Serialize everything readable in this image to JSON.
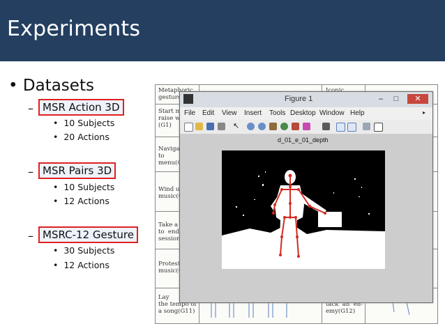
{
  "slide": {
    "title": "Experiments",
    "bullet": "Datasets",
    "datasets": [
      {
        "name": "MSR Action 3D",
        "details": [
          "10 Subjects",
          "20 Actions"
        ]
      },
      {
        "name": "MSR Pairs 3D",
        "details": [
          "10 Subjects",
          "12 Actions"
        ]
      },
      {
        "name": "MSRC-12 Gesture",
        "details": [
          "30 Subjects",
          "12 Actions"
        ]
      }
    ]
  },
  "paper_table": {
    "header_left": "Metaphoric\ngestures",
    "header_right": "Iconic",
    "rows": [
      "Start m\nraise w\n(G1)",
      "Naviga\nto\nmenu(G",
      "Wind u\nmusic(G",
      "Take a\nto  end\nsession(",
      "Protest\nmusic(G",
      "Lay\nthe tempo of\na song(G11)"
    ],
    "right_bottom": "tack  an  en-\nemy(G12)"
  },
  "figure_window": {
    "title": "Figure 1",
    "menu": [
      "File",
      "Edit",
      "View",
      "Insert",
      "Tools",
      "Desktop",
      "Window",
      "Help"
    ],
    "plot_title": "d_01_e_01_depth"
  },
  "colors": {
    "title_bar": "#243f60",
    "highlight_border": "#e02020",
    "skeleton": "#d42a1f"
  }
}
